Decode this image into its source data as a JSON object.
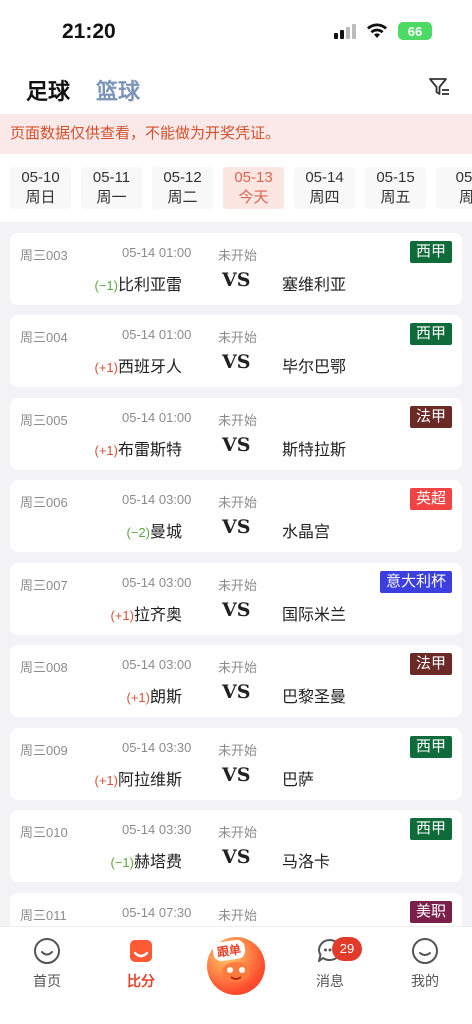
{
  "status_bar": {
    "time": "21:20",
    "battery": "66"
  },
  "header": {
    "tab_football": "足球",
    "tab_basketball": "篮球"
  },
  "notice": "页面数据仅供查看，不能做为开奖凭证。",
  "dates": [
    {
      "date": "05-10",
      "day": "周日"
    },
    {
      "date": "05-11",
      "day": "周一"
    },
    {
      "date": "05-12",
      "day": "周二"
    },
    {
      "date": "05-13",
      "day": "今天"
    },
    {
      "date": "05-14",
      "day": "周四"
    },
    {
      "date": "05-15",
      "day": "周五"
    },
    {
      "date": "05-",
      "day": "周"
    }
  ],
  "matches": [
    {
      "code": "周三003",
      "time": "05-14 01:00",
      "status": "未开始",
      "league": "西甲",
      "league_color": "#0f6b3a",
      "handicap": "(−1)",
      "handicap_type": "neg",
      "home": "比利亚雷",
      "vs": "VS",
      "away": "塞维利亚"
    },
    {
      "code": "周三004",
      "time": "05-14 01:00",
      "status": "未开始",
      "league": "西甲",
      "league_color": "#0f6b3a",
      "handicap": "(+1)",
      "handicap_type": "pos",
      "home": "西班牙人",
      "vs": "VS",
      "away": "毕尔巴鄂"
    },
    {
      "code": "周三005",
      "time": "05-14 01:00",
      "status": "未开始",
      "league": "法甲",
      "league_color": "#6b2a26",
      "handicap": "(+1)",
      "handicap_type": "pos",
      "home": "布雷斯特",
      "vs": "VS",
      "away": "斯特拉斯"
    },
    {
      "code": "周三006",
      "time": "05-14 03:00",
      "status": "未开始",
      "league": "英超",
      "league_color": "#f04343",
      "handicap": "(−2)",
      "handicap_type": "neg",
      "home": "曼城",
      "vs": "VS",
      "away": "水晶宫"
    },
    {
      "code": "周三007",
      "time": "05-14 03:00",
      "status": "未开始",
      "league": "意大利杯",
      "league_color": "#3c3fe0",
      "handicap": "(+1)",
      "handicap_type": "pos",
      "home": "拉齐奥",
      "vs": "VS",
      "away": "国际米兰"
    },
    {
      "code": "周三008",
      "time": "05-14 03:00",
      "status": "未开始",
      "league": "法甲",
      "league_color": "#6b2a26",
      "handicap": "(+1)",
      "handicap_type": "pos",
      "home": "朗斯",
      "vs": "VS",
      "away": "巴黎圣曼"
    },
    {
      "code": "周三009",
      "time": "05-14 03:30",
      "status": "未开始",
      "league": "西甲",
      "league_color": "#0f6b3a",
      "handicap": "(+1)",
      "handicap_type": "pos",
      "home": "阿拉维斯",
      "vs": "VS",
      "away": "巴萨"
    },
    {
      "code": "周三010",
      "time": "05-14 03:30",
      "status": "未开始",
      "league": "西甲",
      "league_color": "#0f6b3a",
      "handicap": "(−1)",
      "handicap_type": "neg",
      "home": "赫塔费",
      "vs": "VS",
      "away": "马洛卡"
    },
    {
      "code": "周三011",
      "time": "05-14 07:30",
      "status": "未开始",
      "league": "美职",
      "league_color": "#7a1f4a",
      "handicap": "",
      "handicap_type": "pos",
      "home": "",
      "vs": "",
      "away": ""
    }
  ],
  "nav": {
    "home": "首页",
    "score": "比分",
    "follow": "跟单",
    "messages": "消息",
    "messages_badge": "29",
    "mine": "我的"
  }
}
